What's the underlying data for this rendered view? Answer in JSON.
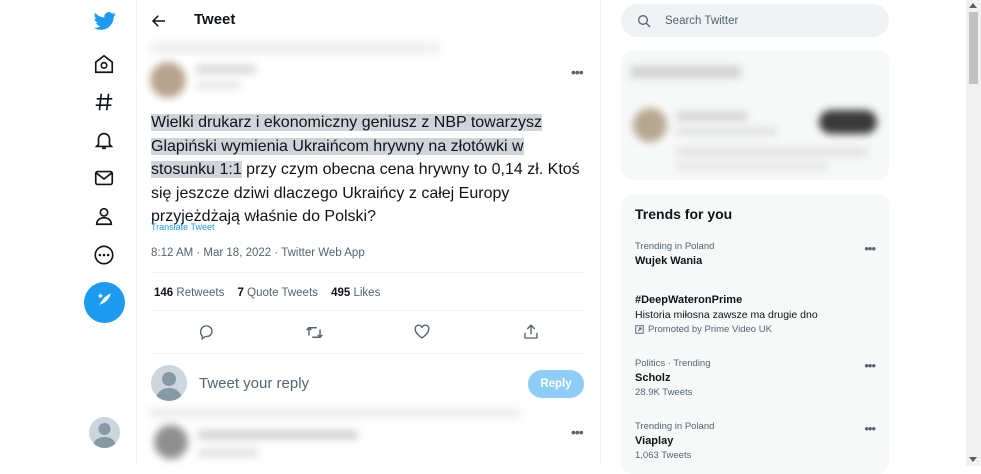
{
  "header": {
    "title": "Tweet"
  },
  "tweet": {
    "text_highlighted": "Wielki drukarz i ekonomiczny geniusz z NBP towarzysz Glapiński wymienia Ukraińcom hrywny na złotówki w stosunku 1:1",
    "text_rest": " przy czym obecna cena hrywny to 0,14 zł. Ktoś się jeszcze dziwi dlaczego Ukraińcy z całej Europy przyjeżdżają właśnie do Polski?",
    "translate_label": "Translate Tweet",
    "meta": "8:12 AM · Mar 18, 2022 · Twitter Web App",
    "retweets_count": "146",
    "retweets_label": "Retweets",
    "quotes_count": "7",
    "quotes_label": "Quote Tweets",
    "likes_count": "495",
    "likes_label": "Likes"
  },
  "reply": {
    "placeholder": "Tweet your reply",
    "button_label": "Reply"
  },
  "search": {
    "placeholder": "Search Twitter"
  },
  "trends": {
    "title": "Trends for you",
    "items": [
      {
        "context": "Trending in Poland",
        "name": "Wujek Wania",
        "description": "",
        "promoted": "",
        "tweets": ""
      },
      {
        "context": "",
        "name": "#DeepWateronPrime",
        "description": "Historia miłosna zawsze ma drugie dno",
        "promoted": "Promoted by Prime Video UK",
        "tweets": ""
      },
      {
        "context": "Politics · Trending",
        "name": "Scholz",
        "description": "",
        "promoted": "",
        "tweets": "28.9K Tweets"
      },
      {
        "context": "Trending in Poland",
        "name": "Viaplay",
        "description": "",
        "promoted": "",
        "tweets": "1,063 Tweets"
      }
    ]
  },
  "icons": {
    "brand": "twitter-bird-icon",
    "nav": [
      "home-icon",
      "explore-hashtag-icon",
      "notifications-bell-icon",
      "messages-envelope-icon",
      "profile-icon",
      "more-circle-icon",
      "compose-tweet-icon"
    ],
    "actions": [
      "reply-icon",
      "retweet-icon",
      "like-icon",
      "share-icon"
    ]
  },
  "colors": {
    "accent": "#1d9bf0",
    "reply_button": "#8ecdf8",
    "highlight": "#cfd4d8"
  }
}
